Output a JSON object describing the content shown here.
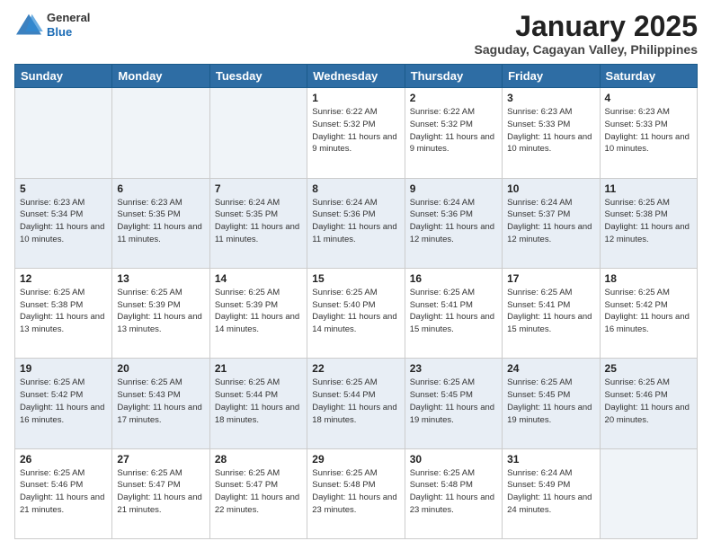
{
  "header": {
    "logo_general": "General",
    "logo_blue": "Blue",
    "month_title": "January 2025",
    "location": "Saguday, Cagayan Valley, Philippines"
  },
  "days_of_week": [
    "Sunday",
    "Monday",
    "Tuesday",
    "Wednesday",
    "Thursday",
    "Friday",
    "Saturday"
  ],
  "weeks": [
    [
      {
        "day": "",
        "empty": true
      },
      {
        "day": "",
        "empty": true
      },
      {
        "day": "",
        "empty": true
      },
      {
        "day": "1",
        "sunrise": "6:22 AM",
        "sunset": "5:32 PM",
        "daylight": "11 hours and 9 minutes."
      },
      {
        "day": "2",
        "sunrise": "6:22 AM",
        "sunset": "5:32 PM",
        "daylight": "11 hours and 9 minutes."
      },
      {
        "day": "3",
        "sunrise": "6:23 AM",
        "sunset": "5:33 PM",
        "daylight": "11 hours and 10 minutes."
      },
      {
        "day": "4",
        "sunrise": "6:23 AM",
        "sunset": "5:33 PM",
        "daylight": "11 hours and 10 minutes."
      }
    ],
    [
      {
        "day": "5",
        "sunrise": "6:23 AM",
        "sunset": "5:34 PM",
        "daylight": "11 hours and 10 minutes."
      },
      {
        "day": "6",
        "sunrise": "6:23 AM",
        "sunset": "5:35 PM",
        "daylight": "11 hours and 11 minutes."
      },
      {
        "day": "7",
        "sunrise": "6:24 AM",
        "sunset": "5:35 PM",
        "daylight": "11 hours and 11 minutes."
      },
      {
        "day": "8",
        "sunrise": "6:24 AM",
        "sunset": "5:36 PM",
        "daylight": "11 hours and 11 minutes."
      },
      {
        "day": "9",
        "sunrise": "6:24 AM",
        "sunset": "5:36 PM",
        "daylight": "11 hours and 12 minutes."
      },
      {
        "day": "10",
        "sunrise": "6:24 AM",
        "sunset": "5:37 PM",
        "daylight": "11 hours and 12 minutes."
      },
      {
        "day": "11",
        "sunrise": "6:25 AM",
        "sunset": "5:38 PM",
        "daylight": "11 hours and 12 minutes."
      }
    ],
    [
      {
        "day": "12",
        "sunrise": "6:25 AM",
        "sunset": "5:38 PM",
        "daylight": "11 hours and 13 minutes."
      },
      {
        "day": "13",
        "sunrise": "6:25 AM",
        "sunset": "5:39 PM",
        "daylight": "11 hours and 13 minutes."
      },
      {
        "day": "14",
        "sunrise": "6:25 AM",
        "sunset": "5:39 PM",
        "daylight": "11 hours and 14 minutes."
      },
      {
        "day": "15",
        "sunrise": "6:25 AM",
        "sunset": "5:40 PM",
        "daylight": "11 hours and 14 minutes."
      },
      {
        "day": "16",
        "sunrise": "6:25 AM",
        "sunset": "5:41 PM",
        "daylight": "11 hours and 15 minutes."
      },
      {
        "day": "17",
        "sunrise": "6:25 AM",
        "sunset": "5:41 PM",
        "daylight": "11 hours and 15 minutes."
      },
      {
        "day": "18",
        "sunrise": "6:25 AM",
        "sunset": "5:42 PM",
        "daylight": "11 hours and 16 minutes."
      }
    ],
    [
      {
        "day": "19",
        "sunrise": "6:25 AM",
        "sunset": "5:42 PM",
        "daylight": "11 hours and 16 minutes."
      },
      {
        "day": "20",
        "sunrise": "6:25 AM",
        "sunset": "5:43 PM",
        "daylight": "11 hours and 17 minutes."
      },
      {
        "day": "21",
        "sunrise": "6:25 AM",
        "sunset": "5:44 PM",
        "daylight": "11 hours and 18 minutes."
      },
      {
        "day": "22",
        "sunrise": "6:25 AM",
        "sunset": "5:44 PM",
        "daylight": "11 hours and 18 minutes."
      },
      {
        "day": "23",
        "sunrise": "6:25 AM",
        "sunset": "5:45 PM",
        "daylight": "11 hours and 19 minutes."
      },
      {
        "day": "24",
        "sunrise": "6:25 AM",
        "sunset": "5:45 PM",
        "daylight": "11 hours and 19 minutes."
      },
      {
        "day": "25",
        "sunrise": "6:25 AM",
        "sunset": "5:46 PM",
        "daylight": "11 hours and 20 minutes."
      }
    ],
    [
      {
        "day": "26",
        "sunrise": "6:25 AM",
        "sunset": "5:46 PM",
        "daylight": "11 hours and 21 minutes."
      },
      {
        "day": "27",
        "sunrise": "6:25 AM",
        "sunset": "5:47 PM",
        "daylight": "11 hours and 21 minutes."
      },
      {
        "day": "28",
        "sunrise": "6:25 AM",
        "sunset": "5:47 PM",
        "daylight": "11 hours and 22 minutes."
      },
      {
        "day": "29",
        "sunrise": "6:25 AM",
        "sunset": "5:48 PM",
        "daylight": "11 hours and 23 minutes."
      },
      {
        "day": "30",
        "sunrise": "6:25 AM",
        "sunset": "5:48 PM",
        "daylight": "11 hours and 23 minutes."
      },
      {
        "day": "31",
        "sunrise": "6:24 AM",
        "sunset": "5:49 PM",
        "daylight": "11 hours and 24 minutes."
      },
      {
        "day": "",
        "empty": true
      }
    ]
  ],
  "labels": {
    "sunrise": "Sunrise:",
    "sunset": "Sunset:",
    "daylight": "Daylight:"
  }
}
